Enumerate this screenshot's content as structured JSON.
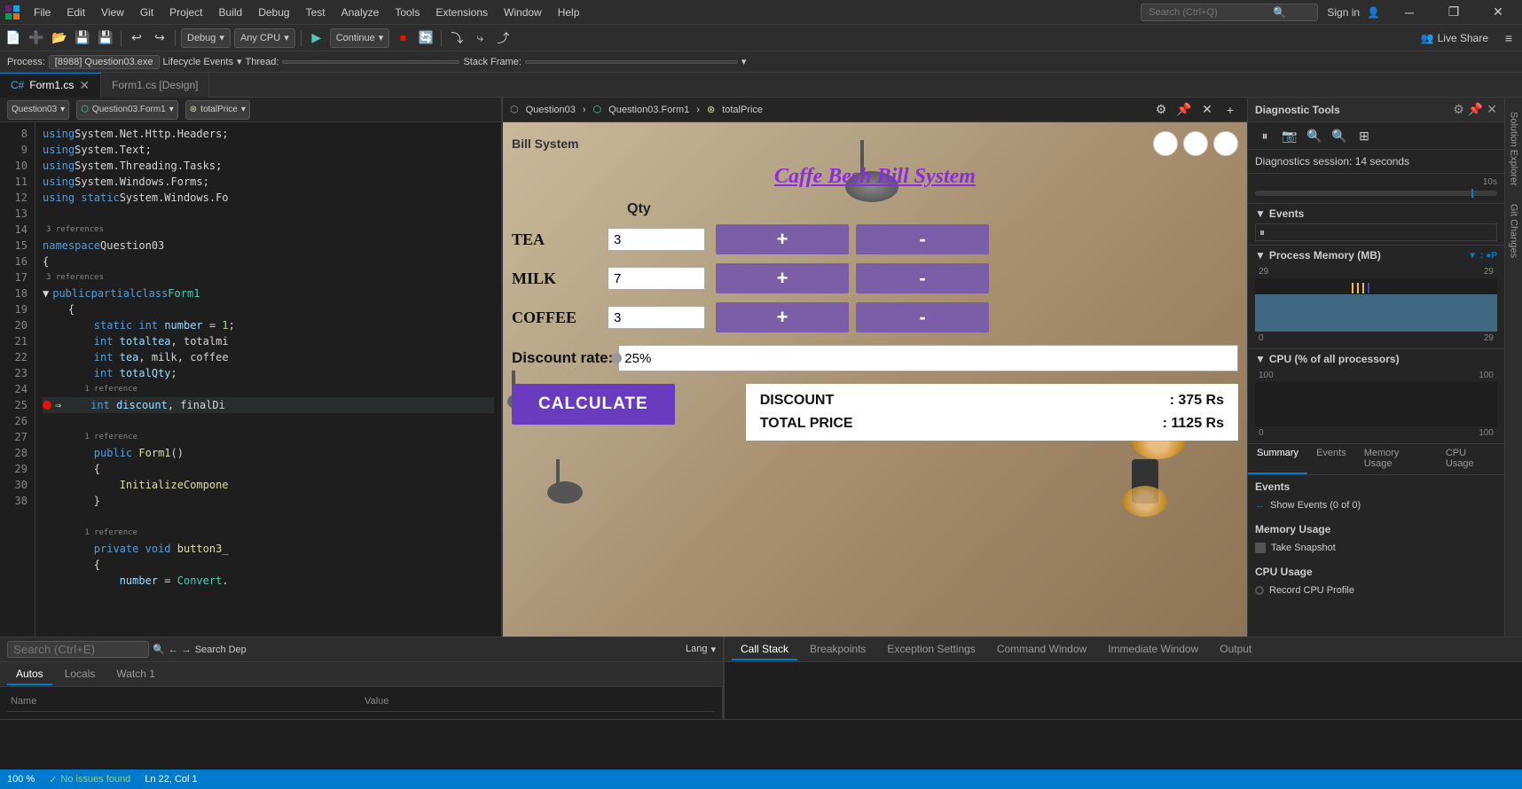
{
  "window": {
    "title": "Question03",
    "sign_in": "Sign in"
  },
  "menu": {
    "items": [
      "File",
      "Edit",
      "View",
      "Git",
      "Project",
      "Build",
      "Debug",
      "Test",
      "Analyze",
      "Tools",
      "Extensions",
      "Window",
      "Help"
    ],
    "search_placeholder": "Search (Ctrl+Q)"
  },
  "toolbar": {
    "debug_config": "Debug",
    "cpu_config": "Any CPU",
    "continue_label": "Continue",
    "live_share": "Live Share"
  },
  "process_bar": {
    "process_label": "Process:",
    "process_value": "[8988] Question03.exe",
    "lifecycle_label": "Lifecycle Events",
    "thread_label": "Thread:",
    "stack_frame_label": "Stack Frame:"
  },
  "tabs": [
    {
      "label": "Form1.cs",
      "icon": "cs-file",
      "active": true,
      "closeable": true
    },
    {
      "label": "Form1.cs [Design]",
      "active": false,
      "closeable": false
    }
  ],
  "code_header": {
    "namespace": "Question03",
    "class": "Question03.Form1",
    "member": "totalPrice"
  },
  "code": {
    "lines": [
      {
        "num": 8,
        "text": "using System.Net.Http.Headers;"
      },
      {
        "num": 9,
        "text": "using System.Text;"
      },
      {
        "num": 10,
        "text": "using System.Threading.Tasks;"
      },
      {
        "num": 11,
        "text": "using System.Windows.Forms;"
      },
      {
        "num": 12,
        "text": "using static System.Windows.Fo"
      },
      {
        "num": 13,
        "text": ""
      },
      {
        "num": 14,
        "refs": "3 references",
        "text": "namespace Question03"
      },
      {
        "num": 15,
        "text": "{"
      },
      {
        "num": 16,
        "refs": "3 references",
        "text": "    public partial class Form1"
      },
      {
        "num": 17,
        "text": "    {"
      },
      {
        "num": 18,
        "text": "        static int number = 1;"
      },
      {
        "num": 19,
        "text": "        int totaltea, totalmi"
      },
      {
        "num": 20,
        "text": "        int tea, milk, coffee"
      },
      {
        "num": 21,
        "text": "        int totalQty;"
      },
      {
        "num": 22,
        "refs": "1 reference",
        "text": "        int discount, finalDi",
        "breakpoint": true,
        "arrow": true
      },
      {
        "num": 23,
        "text": ""
      },
      {
        "num": 24,
        "refs": "1 reference",
        "text": "        public Form1()"
      },
      {
        "num": 25,
        "text": "        {"
      },
      {
        "num": 26,
        "text": "            InitializeCompone"
      },
      {
        "num": 27,
        "text": "        }"
      },
      {
        "num": 28,
        "text": ""
      },
      {
        "num": 29,
        "refs": "1 reference",
        "text": "        private void button3_"
      },
      {
        "num": 30,
        "text": "        {"
      },
      {
        "num": 38,
        "text": "            number = Convert."
      }
    ]
  },
  "form_designer": {
    "title": "Bill System",
    "app_title": "Caffe Besh Bill System",
    "qty_label": "Qty",
    "items": [
      {
        "name": "TEA",
        "value": "3"
      },
      {
        "name": "MILK",
        "value": "7"
      },
      {
        "name": "COFFEE",
        "value": "3"
      }
    ],
    "plus_label": "+",
    "minus_label": "-",
    "discount_label": "Discount rate:",
    "discount_value": "25%",
    "calculate_label": "CALCULATE",
    "discount_result_label": "DISCOUNT",
    "discount_result_value": ": 375 Rs",
    "total_label": "TOTAL PRICE",
    "total_value": ": 1125 Rs"
  },
  "diagnostics": {
    "title": "Diagnostic Tools",
    "session_label": "Diagnostics session: 14 seconds",
    "timeline_label": "10s",
    "events_section": "Events",
    "process_memory_section": "Process Memory (MB)",
    "memory_min": "0",
    "memory_max": "29",
    "memory_left_val": "29",
    "memory_right_val": "29",
    "cpu_section": "CPU (% of all processors)",
    "cpu_min": "0",
    "cpu_max": "100",
    "cpu_left_val": "100",
    "cpu_right_val": "100",
    "tabs": [
      "Summary",
      "Events",
      "Memory Usage",
      "CPU Usage"
    ],
    "active_tab": "Summary",
    "events_title": "Events",
    "show_events_label": "Show Events (0 of 0)",
    "memory_title": "Memory Usage",
    "take_snapshot_label": "Take Snapshot",
    "cpu_title": "CPU Usage",
    "record_cpu_label": "Record CPU Profile"
  },
  "bottom_panel": {
    "tabs": [
      "Autos",
      "Locals",
      "Watch 1"
    ],
    "active_tab": "Autos",
    "search_placeholder": "Search (Ctrl+E)",
    "columns": [
      "Name",
      "Value"
    ],
    "call_stack_tabs": [
      "Call Stack",
      "Breakpoints",
      "Exception Settings",
      "Command Window",
      "Immediate Window",
      "Output"
    ],
    "active_call_stack_tab": "Call Stack",
    "lang_label": "Lang"
  },
  "status_bar": {
    "process": "100 %",
    "status": "No issues found",
    "zoom": "100 %"
  }
}
